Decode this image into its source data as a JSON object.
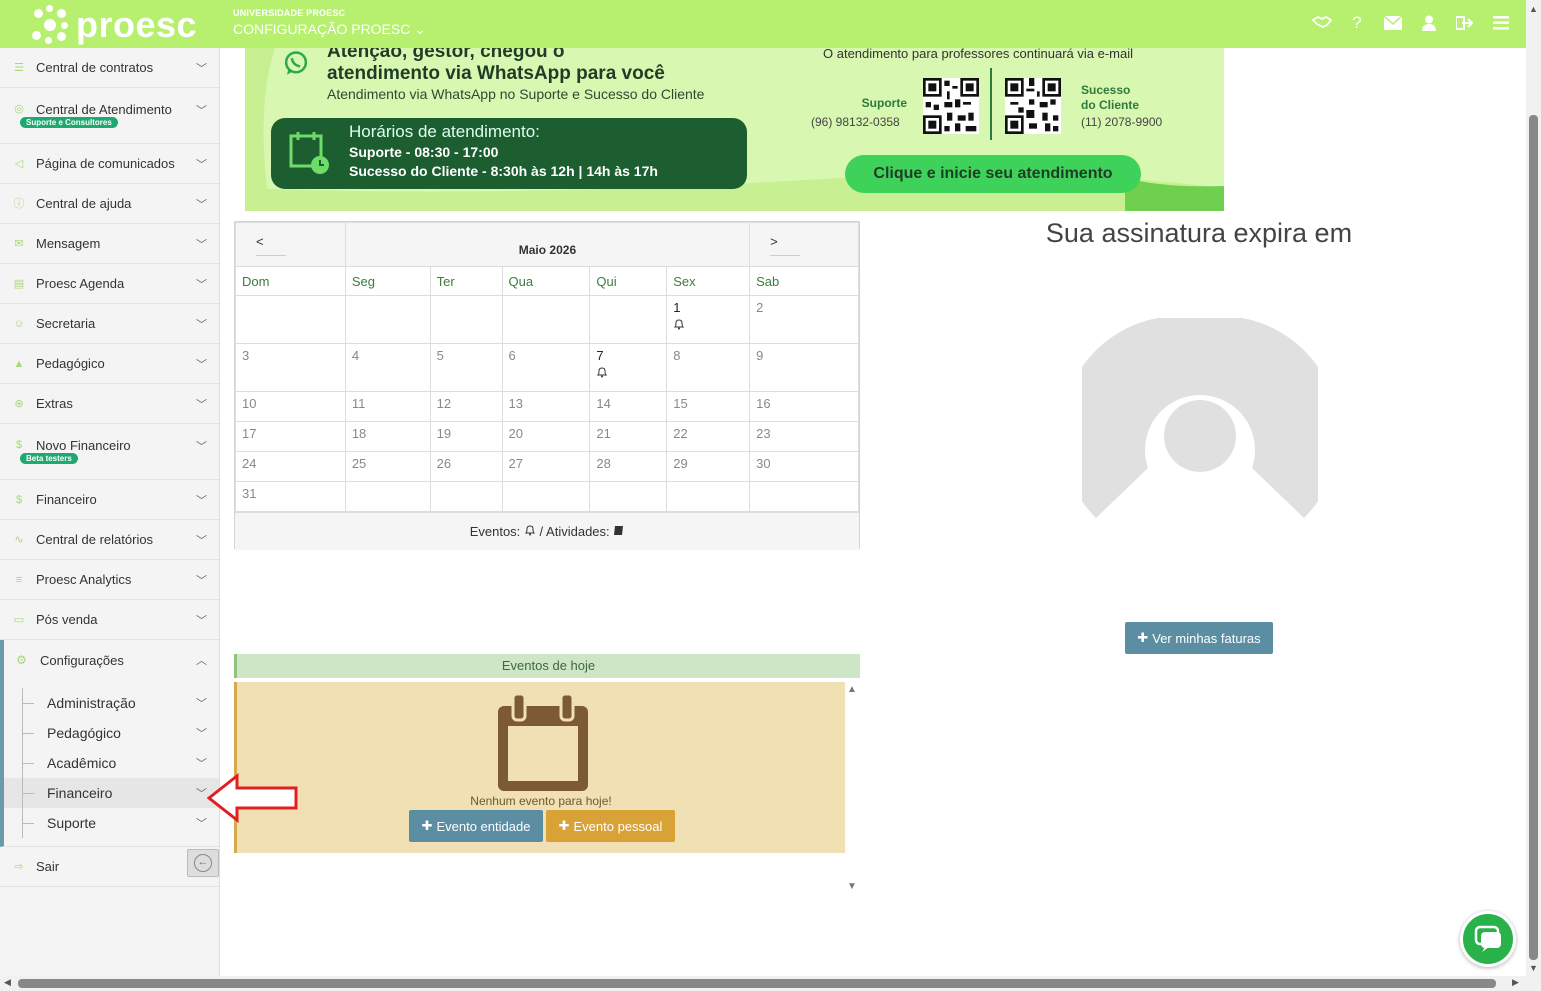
{
  "header": {
    "logo_text": "proesc",
    "institution_name": "UNIVERSIDADE PROESC",
    "section": "CONFIGURAÇÃO PROESC ⌄",
    "icons": [
      "handshake-icon",
      "help-icon",
      "mail-icon",
      "user-icon",
      "logout-icon",
      "menu-icon"
    ]
  },
  "sidebar": {
    "items": [
      {
        "label": "Central de contratos",
        "icon": "list-icon"
      },
      {
        "label": "Central de Atendimento",
        "icon": "headset-icon",
        "badge": "Suporte e Consultores"
      },
      {
        "label": "Página de comunicados",
        "icon": "megaphone-icon"
      },
      {
        "label": "Central de ajuda",
        "icon": "info-icon"
      },
      {
        "label": "Mensagem",
        "icon": "envelope-icon"
      },
      {
        "label": "Proesc Agenda",
        "icon": "book-icon"
      },
      {
        "label": "Secretaria",
        "icon": "users-icon"
      },
      {
        "label": "Pedagógico",
        "icon": "graduation-icon"
      },
      {
        "label": "Extras",
        "icon": "plus-circle-icon"
      },
      {
        "label": "Novo Financeiro",
        "icon": "dollar-icon",
        "badge": "Beta testers"
      },
      {
        "label": "Financeiro",
        "icon": "dollar-icon"
      },
      {
        "label": "Central de relatórios",
        "icon": "chart-icon"
      },
      {
        "label": "Proesc Analytics",
        "icon": "database-icon"
      },
      {
        "label": "Pós venda",
        "icon": "ticket-icon"
      }
    ],
    "config": {
      "label": "Configurações",
      "subitems": [
        "Administração",
        "Pedagógico",
        "Acadêmico",
        "Financeiro",
        "Suporte"
      ]
    },
    "logout": "Sair"
  },
  "banner": {
    "title_line1": "Atenção, gestor, chegou o",
    "title_line2": "atendimento via WhatsApp para você",
    "subtitle": "Atendimento via WhatsApp no Suporte e Sucesso do Cliente",
    "hours_title": "Horários de atendimento:",
    "hours_support": "Suporte - 08:30 - 17:00",
    "hours_success": "Sucesso do Cliente - 8:30h às 12h | 14h às 17h",
    "email_note": "O atendimento para professores continuará via e-mail",
    "support_label": "Suporte",
    "support_phone": "(96) 98132-0358",
    "success_label_1": "Sucesso",
    "success_label_2": "do Cliente",
    "success_phone": "(11) 2078-9900",
    "cta": "Clique e inicie seu atendimento"
  },
  "calendar": {
    "prev": "<",
    "next": ">",
    "month": "Maio 2026",
    "weekdays": [
      "Dom",
      "Seg",
      "Ter",
      "Qua",
      "Qui",
      "Sex",
      "Sab"
    ],
    "weeks": [
      [
        "",
        "",
        "",
        "",
        "",
        "1",
        "2"
      ],
      [
        "3",
        "4",
        "5",
        "6",
        "7",
        "8",
        "9"
      ],
      [
        "10",
        "11",
        "12",
        "13",
        "14",
        "15",
        "16"
      ],
      [
        "17",
        "18",
        "19",
        "20",
        "21",
        "22",
        "23"
      ],
      [
        "24",
        "25",
        "26",
        "27",
        "28",
        "29",
        "30"
      ],
      [
        "31",
        "",
        "",
        "",
        "",
        "",
        ""
      ]
    ],
    "event_days": [
      "1",
      "7"
    ],
    "footer_events": "Eventos:",
    "footer_activities": "/ Atividades:"
  },
  "events_today": {
    "title": "Eventos de hoje",
    "empty": "Nenhum evento para hoje!",
    "btn_entity": "Evento entidade",
    "btn_personal": "Evento pessoal"
  },
  "subscription": {
    "title": "Sua assinatura expira em",
    "btn_invoices": "Ver minhas faturas"
  },
  "colors": {
    "header": "#b6f06e",
    "accent_blue": "#5b8ea3",
    "accent_orange": "#d9a236",
    "events_bg": "#f0e0b4",
    "chat": "#29b24a"
  }
}
